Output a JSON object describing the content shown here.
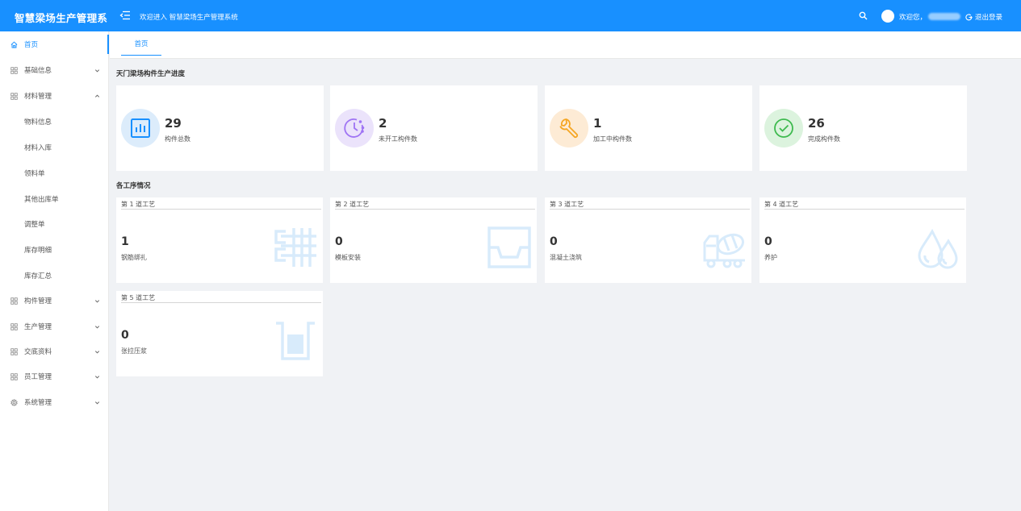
{
  "header": {
    "app_title": "智慧梁场生产管理系",
    "welcome": "欢迎进入 智慧梁场生产管理系统",
    "greeting": "欢迎您，",
    "username": "admin",
    "logout": "退出登录",
    "brand_color": "#1890ff"
  },
  "sidebar": {
    "items": [
      {
        "label": "首页",
        "icon": "home-icon",
        "active": true
      },
      {
        "label": "基础信息",
        "icon": "grid-icon",
        "expanded": false
      },
      {
        "label": "材料管理",
        "icon": "grid-icon",
        "expanded": true
      },
      {
        "label": "物料信息",
        "sub": true
      },
      {
        "label": "材料入库",
        "sub": true
      },
      {
        "label": "领料单",
        "sub": true
      },
      {
        "label": "其他出库单",
        "sub": true
      },
      {
        "label": "调整单",
        "sub": true
      },
      {
        "label": "库存明细",
        "sub": true
      },
      {
        "label": "库存汇总",
        "sub": true
      },
      {
        "label": "构件管理",
        "icon": "grid-icon",
        "expanded": false
      },
      {
        "label": "生产管理",
        "icon": "grid-icon",
        "expanded": false
      },
      {
        "label": "交底资料",
        "icon": "grid-icon",
        "expanded": false
      },
      {
        "label": "员工管理",
        "icon": "grid-icon",
        "expanded": false
      },
      {
        "label": "系统管理",
        "icon": "gear-icon",
        "expanded": false
      }
    ]
  },
  "tabs": [
    {
      "label": "首页",
      "active": true
    }
  ],
  "progress": {
    "title": "天门梁场构件生产进度",
    "cards": [
      {
        "value": "29",
        "label": "构件总数",
        "icon": "bar-chart-icon",
        "color": "#1890ff",
        "bg": "#dcecfb"
      },
      {
        "value": "2",
        "label": "未开工构件数",
        "icon": "clock-icon",
        "color": "#9f74f4",
        "bg": "#ebe3fb"
      },
      {
        "value": "1",
        "label": "加工中构件数",
        "icon": "wrench-icon",
        "color": "#f5a623",
        "bg": "#fdebd5"
      },
      {
        "value": "26",
        "label": "完成构件数",
        "icon": "check-circle-icon",
        "color": "#3dba4e",
        "bg": "#dcf3de"
      }
    ]
  },
  "processes": {
    "title": "各工序情况",
    "cards": [
      {
        "step": "第 1 道工艺",
        "value": "1",
        "label": "钢筋绑扎",
        "icon": "rebar-icon"
      },
      {
        "step": "第 2 道工艺",
        "value": "0",
        "label": "模板安装",
        "icon": "formwork-icon"
      },
      {
        "step": "第 3 道工艺",
        "value": "0",
        "label": "混凝土浇筑",
        "icon": "mixer-truck-icon"
      },
      {
        "step": "第 4 道工艺",
        "value": "0",
        "label": "养护",
        "icon": "water-drops-icon"
      },
      {
        "step": "第 5 道工艺",
        "value": "0",
        "label": "张拉压浆",
        "icon": "tension-icon"
      }
    ]
  }
}
